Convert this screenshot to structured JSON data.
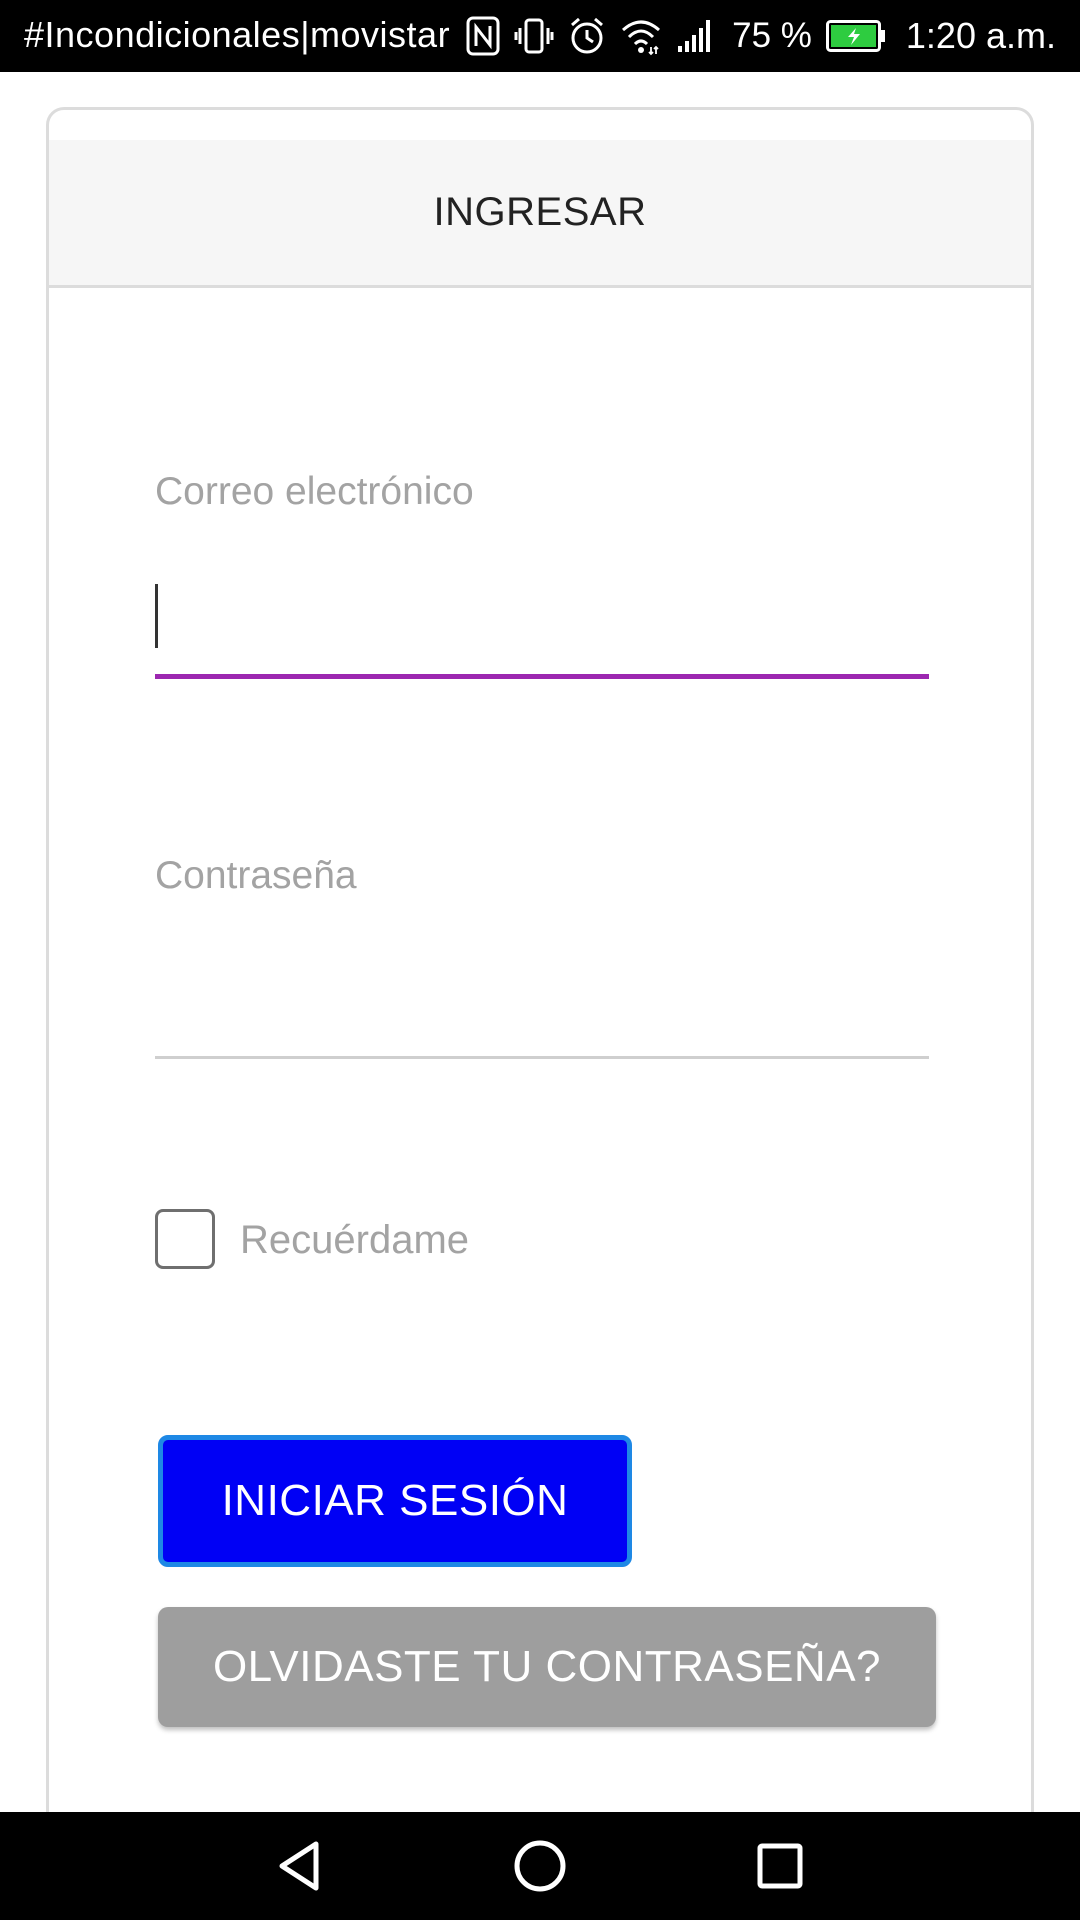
{
  "status_bar": {
    "notification_text": "#Incondicionales|movistar",
    "battery_percent": "75 %",
    "time": "1:20 a.m.",
    "icons": [
      "nfc-icon",
      "vibrate-icon",
      "alarm-icon",
      "wifi-icon",
      "signal-icon",
      "battery-charging-icon"
    ],
    "battery_color": "#2ecc40"
  },
  "card": {
    "title": "INGRESAR"
  },
  "form": {
    "email": {
      "label": "Correo electrónico",
      "value": "",
      "focused": true,
      "accent_color": "#9c27b0"
    },
    "password": {
      "label": "Contraseña",
      "value": ""
    },
    "remember": {
      "label": "Recuérdame",
      "checked": false
    },
    "submit_label": "INICIAR SESIÓN",
    "submit_color": "#0000f5",
    "forgot_label": "OLVIDASTE TU CONTRASEÑA?",
    "forgot_color": "#9e9e9e"
  },
  "nav_bar": {
    "icons": [
      "back-icon",
      "home-icon",
      "recents-icon"
    ]
  }
}
